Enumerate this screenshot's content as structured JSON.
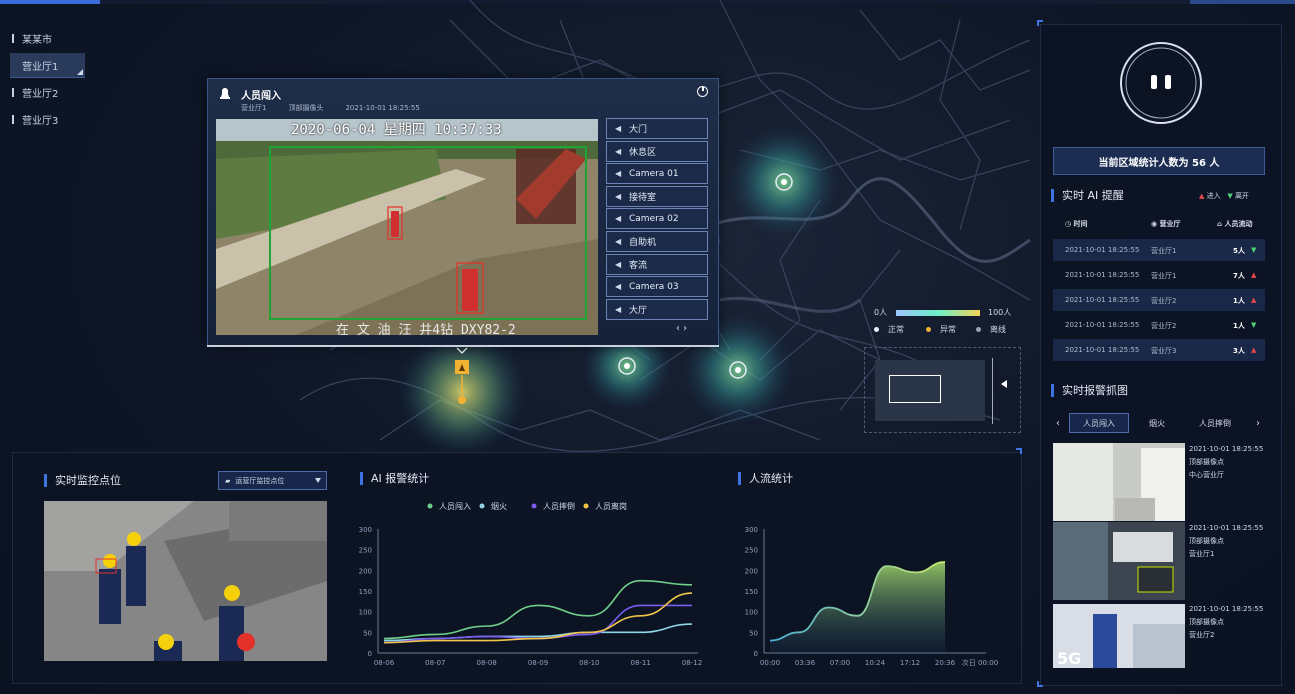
{
  "cities": [
    {
      "label": "某某市",
      "active": false
    },
    {
      "label": "营业厅1",
      "active": true
    },
    {
      "label": "营业厅2",
      "active": false
    },
    {
      "label": "营业厅3",
      "active": false
    }
  ],
  "popup": {
    "title": "人员闯入",
    "hall": "营业厅1",
    "camera": "顶部摄像头",
    "time": "2021-10-01 18:25:55",
    "video_timestamp": "2020-06-04  星期四  10:37:33",
    "video_caption": "在 文 油 汪 井4钻 DXY82-2",
    "cameras": [
      "大门",
      "休息区",
      "Camera 01",
      "接待室",
      "Camera 02",
      "自助机",
      "客流",
      "Camera 03",
      "大厅"
    ],
    "nav": "‹    ›"
  },
  "map_legend": {
    "min": "0人",
    "max": "100人",
    "statuses": [
      {
        "label": "正常",
        "color": "#e8eef8"
      },
      {
        "label": "异常",
        "color": "#f2b233"
      },
      {
        "label": "离线",
        "color": "#9aa3b2"
      }
    ]
  },
  "right": {
    "count_text": "当前区域统计人数为 56 人",
    "ai_title": "实时 AI 提醒",
    "legend_in": "进入",
    "legend_out": "离开",
    "headers": [
      "时间",
      "营业厅",
      "人员流动"
    ],
    "rows": [
      {
        "time": "2021-10-01 18:25:55",
        "hall": "营业厅1",
        "num": "5人",
        "dir": "down"
      },
      {
        "time": "2021-10-01 18:25:55",
        "hall": "营业厅1",
        "num": "7人",
        "dir": "up"
      },
      {
        "time": "2021-10-01 18:25:55",
        "hall": "营业厅2",
        "num": "1人",
        "dir": "up"
      },
      {
        "time": "2021-10-01 18:25:55",
        "hall": "营业厅2",
        "num": "1人",
        "dir": "down"
      },
      {
        "time": "2021-10-01 18:25:55",
        "hall": "营业厅3",
        "num": "3人",
        "dir": "up"
      }
    ],
    "alarm_title": "实时报警抓图",
    "tabs": [
      "人员闯入",
      "烟火",
      "人员摔倒"
    ],
    "snaps": [
      {
        "time": "2021-10-01 18:25:55",
        "camera": "顶部摄像点",
        "hall": "中心营业厅"
      },
      {
        "time": "2021-10-01 18:25:55",
        "camera": "顶部摄像点",
        "hall": "营业厅1"
      },
      {
        "time": "2021-10-01 18:25:55",
        "camera": "顶部摄像点",
        "hall": "营业厅2"
      }
    ]
  },
  "bottom": {
    "monitor_title": "实时监控点位",
    "select_label": "运营厅监控点位",
    "ai_chart_title": "AI 报警统计",
    "flow_chart_title": "人流统计"
  },
  "chart_data": [
    {
      "type": "line",
      "title": "AI 报警统计",
      "x": [
        "08-06",
        "08-07",
        "08-08",
        "08-09",
        "08-10",
        "08-11",
        "08-12"
      ],
      "ylim": [
        0,
        300
      ],
      "yticks": [
        0,
        50,
        100,
        150,
        200,
        250,
        300
      ],
      "series": [
        {
          "name": "人员闯入",
          "color": "#6fd08a",
          "values": [
            35,
            45,
            65,
            115,
            90,
            175,
            165
          ]
        },
        {
          "name": "烟火",
          "color": "#8fd6e8",
          "values": [
            30,
            35,
            40,
            40,
            50,
            50,
            70
          ]
        },
        {
          "name": "人员摔倒",
          "color": "#7b5cf0",
          "values": [
            25,
            35,
            40,
            35,
            45,
            115,
            115
          ]
        },
        {
          "name": "人员离岗",
          "color": "#f2c44a",
          "values": [
            25,
            30,
            30,
            35,
            50,
            90,
            145
          ]
        }
      ]
    },
    {
      "type": "area",
      "title": "人流统计",
      "x": [
        "00:00",
        "03:36",
        "07:00",
        "10:24",
        "17:12",
        "20:36",
        "次日 00:00"
      ],
      "ylim": [
        0,
        300
      ],
      "yticks": [
        0,
        50,
        100,
        150,
        200,
        250,
        300
      ],
      "values": [
        30,
        50,
        110,
        90,
        210,
        195,
        220
      ]
    }
  ]
}
